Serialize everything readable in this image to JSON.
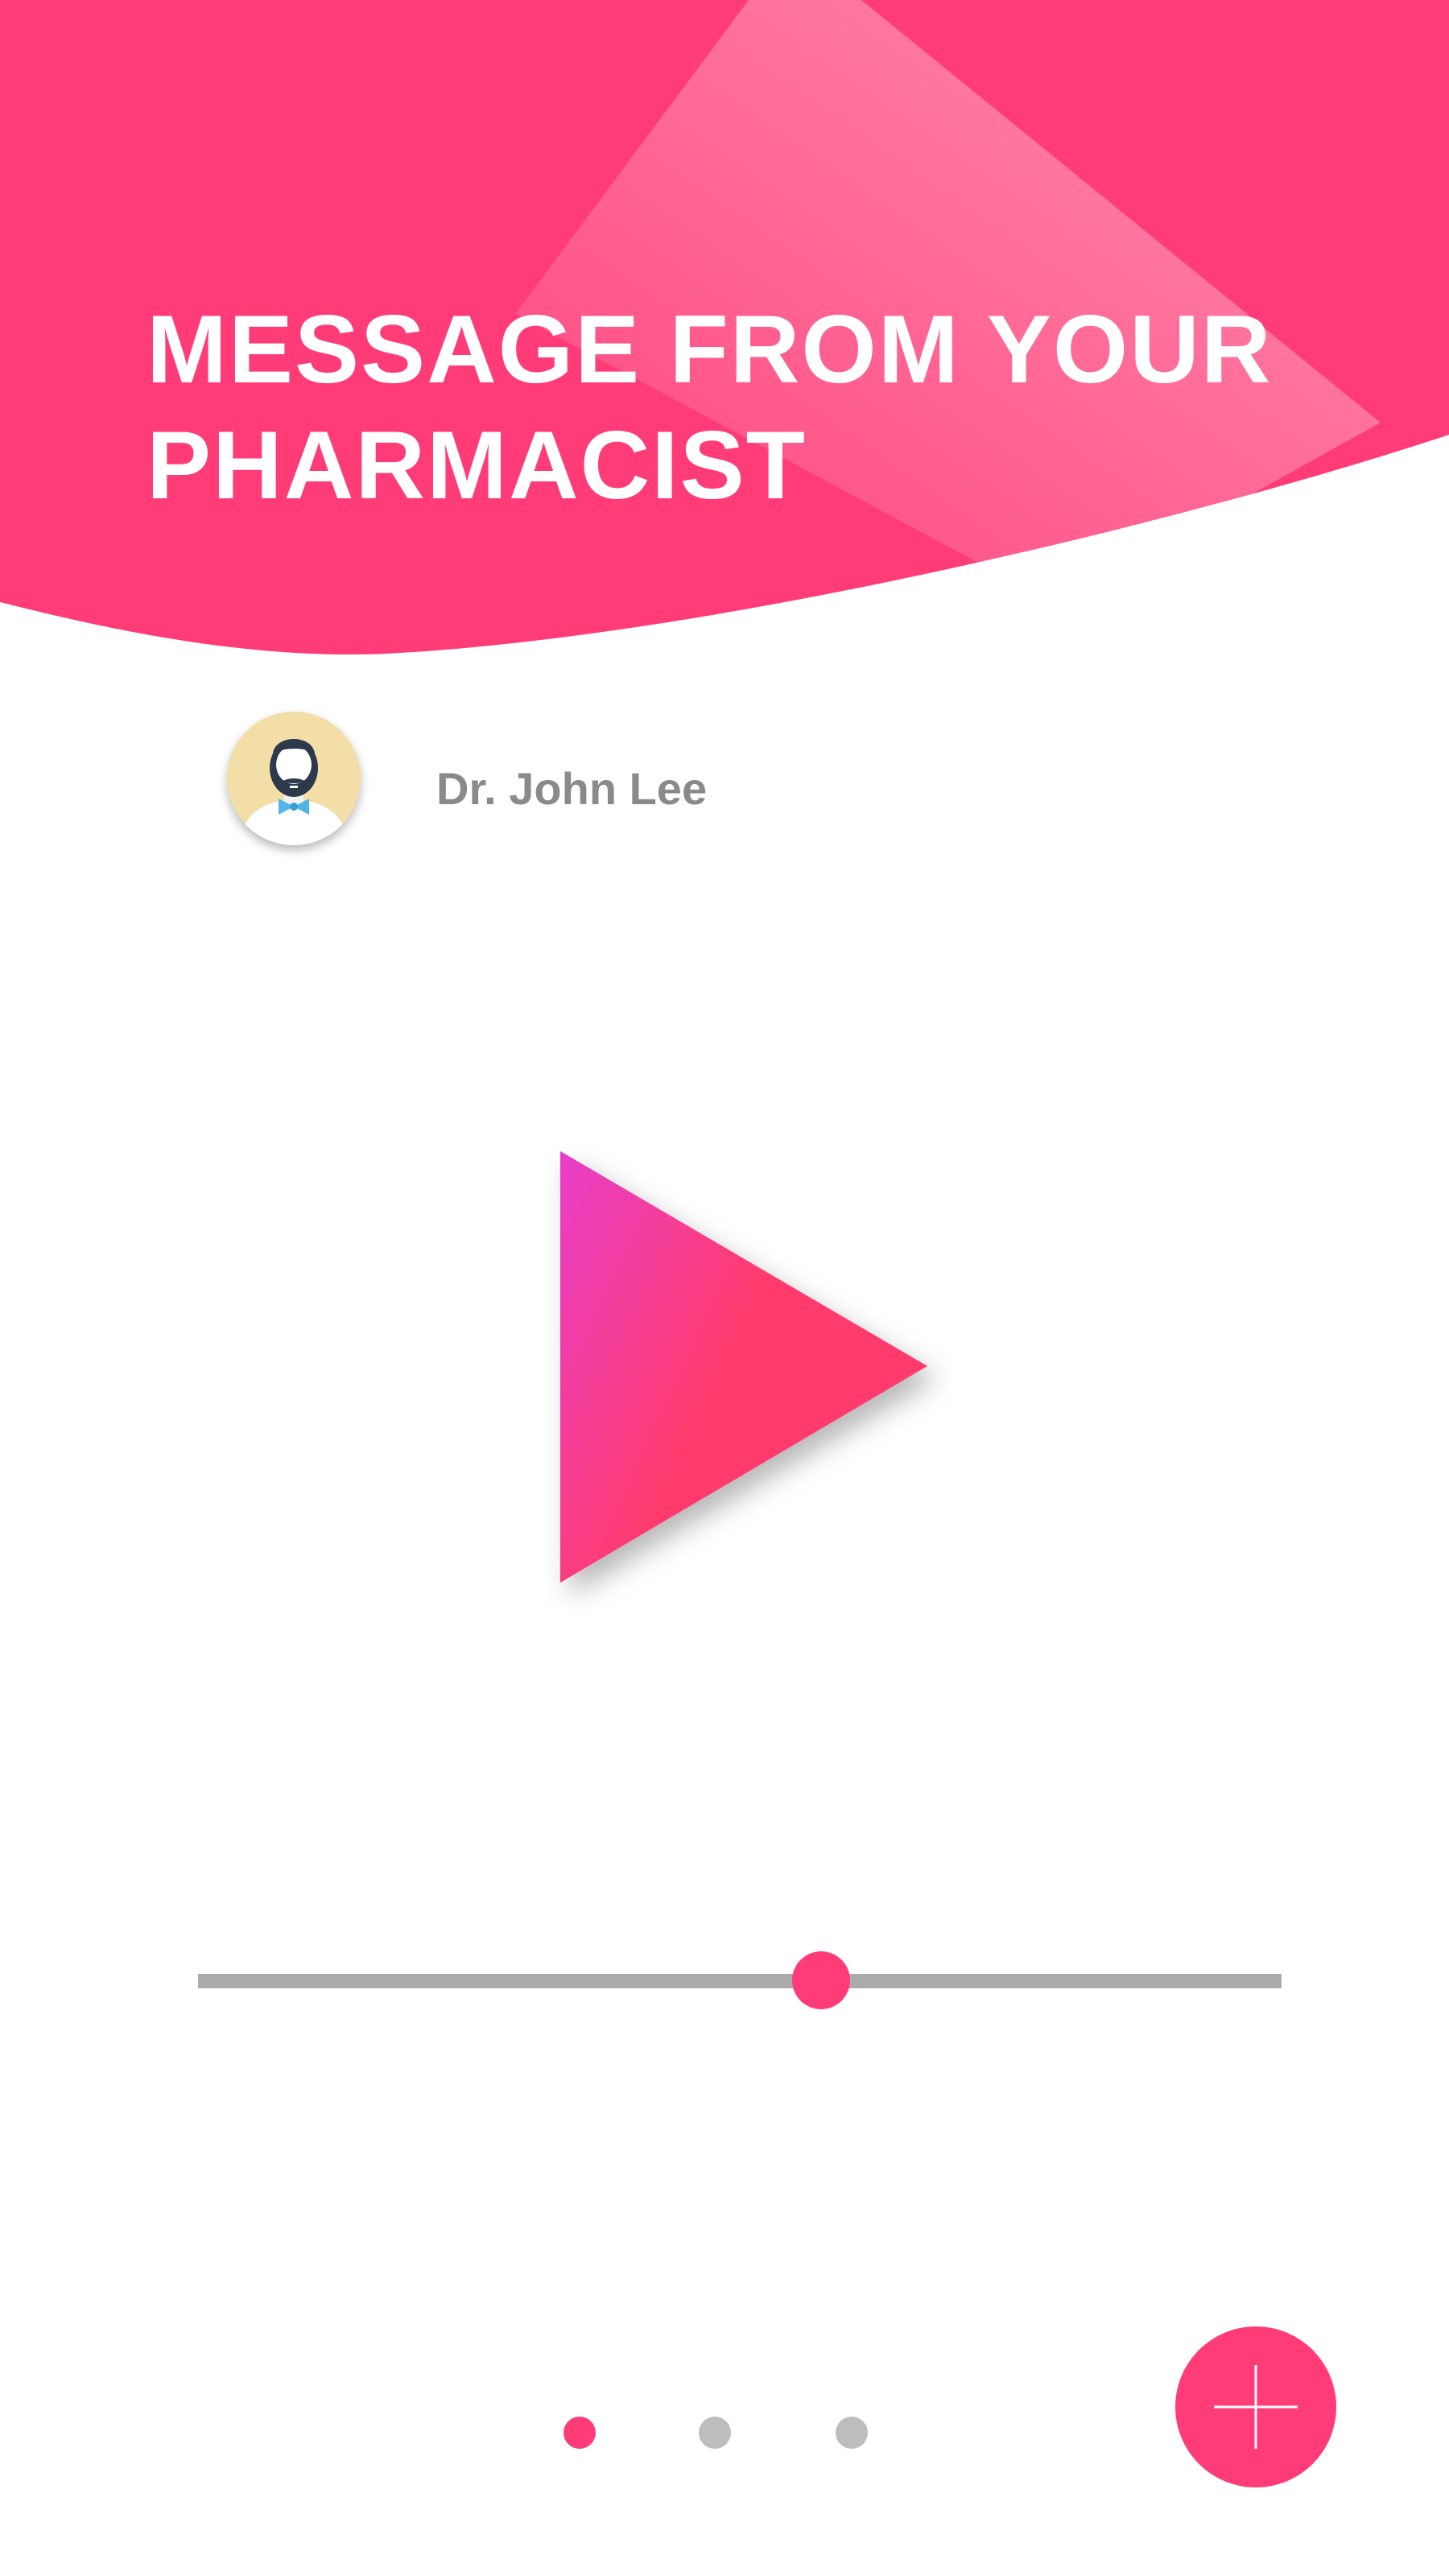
{
  "header": {
    "title_line_1": "MESSAGE FROM YOUR",
    "title_line_2": "PHARMACIST"
  },
  "pharmacist": {
    "name": "Dr. John Lee",
    "avatar_icon": "doctor-avatar-icon"
  },
  "player": {
    "play_icon": "play-icon",
    "progress": 0.575
  },
  "pager": {
    "page_count": 3,
    "active_index": 0
  },
  "fab": {
    "icon": "plus-icon"
  },
  "colors": {
    "accent": "#ff3b78",
    "play_gradient_start": "#e83ec8",
    "play_gradient_end": "#ff3b6e",
    "name_text": "#8a8a8a",
    "inactive_dot": "#bdbdbd",
    "track": "#ababab"
  }
}
